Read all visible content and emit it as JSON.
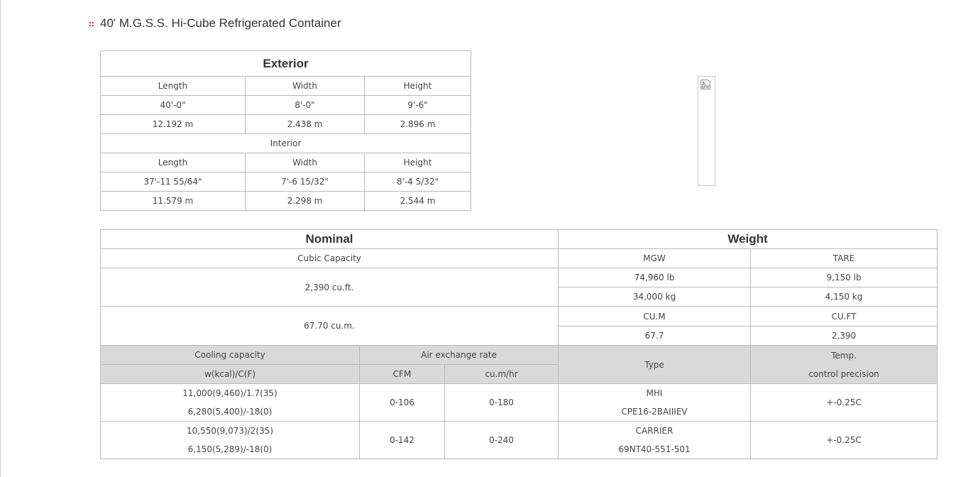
{
  "page": {
    "title": "40' M.G.S.S. Hi-Cube Refrigerated Container",
    "bullet_icon": "red-dot-grid-bullet-icon",
    "accent_color": "#d2232a",
    "border_color": "#b9b9b9",
    "header_bg_color": "#d9d9d9"
  },
  "dimensions": {
    "exterior_heading": "Exterior",
    "columns": [
      "Length",
      "Width",
      "Height"
    ],
    "exterior_rows": [
      [
        "40'-0\"",
        "8'-0\"",
        "9'-6\""
      ],
      [
        "12.192 m",
        "2.438 m",
        "2.896 m"
      ]
    ],
    "interior_heading": "Interior",
    "interior_columns": [
      "Length",
      "Width",
      "Height"
    ],
    "interior_rows": [
      [
        "37'-11 55/64\"",
        "7'-6 15/32\"",
        "8'-4 5/32\""
      ],
      [
        "11.579 m",
        "2.298 m",
        "2.544 m"
      ]
    ]
  },
  "product_image": {
    "icon": "broken-image-icon"
  },
  "specs": {
    "nominal_heading": "Nominal",
    "weight_heading": "Weight",
    "cubic_capacity_label": "Cubic Capacity",
    "cubic_capacity_ft": "2,390 cu.ft.",
    "cubic_capacity_m": "67.70 cu.m.",
    "mgw_label": "MGW",
    "tare_label": "TARE",
    "mgw_lb": "74,960 lb",
    "tare_lb": "9,150 lb",
    "mgw_kg": "34,000 kg",
    "tare_kg": "4,150 kg",
    "cum_label": "CU.M",
    "cuft_label": "CU.FT",
    "cum_value": "67.7",
    "cuft_value": "2,390",
    "cooling_capacity_label": "Cooling capacity",
    "cooling_unit_label": "w(kcal)/C(F)",
    "air_exchange_label": "Air exchange rate",
    "cfm_label": "CFM",
    "cumhr_label": "cu.m/hr",
    "type_label": "Type",
    "temp_label_line1": "Temp.",
    "temp_label_line2": "control precision",
    "units": [
      {
        "cooling_line1": "11,000(9,460)/1.7(35)",
        "cooling_line2": "6,280(5,400)/-18(0)",
        "cfm": "0-106",
        "cumhr": "0-180",
        "type_line1": "MHI",
        "type_line2": "CPE16-2BAIIIEV",
        "temp": "+-0.25C"
      },
      {
        "cooling_line1": "10,550(9,073)/2(35)",
        "cooling_line2": "6,150(5,289)/-18(0)",
        "cfm": "0-142",
        "cumhr": "0-240",
        "type_line1": "CARRIER",
        "type_line2": "69NT40-551-501",
        "temp": "+-0.25C"
      }
    ]
  }
}
